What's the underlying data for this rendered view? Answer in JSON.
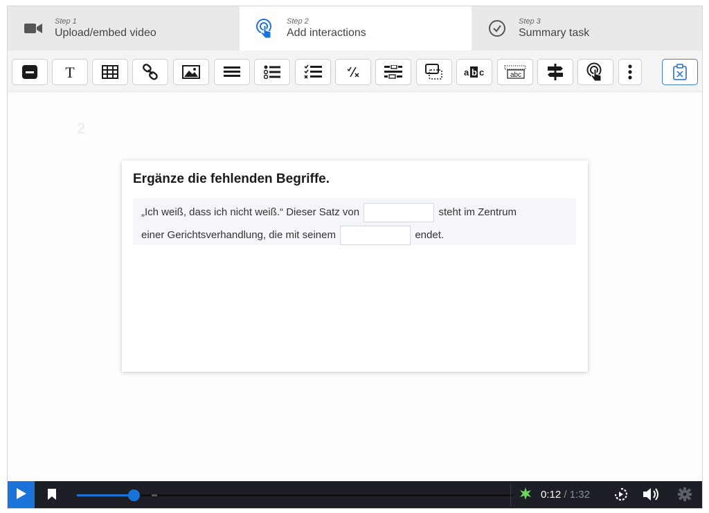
{
  "steps": [
    {
      "num": "Step 1",
      "title": "Upload/embed video",
      "icon": "video-camera-icon",
      "active": false
    },
    {
      "num": "Step 2",
      "title": "Add interactions",
      "icon": "touch-pointer-icon",
      "active": true
    },
    {
      "num": "Step 3",
      "title": "Summary task",
      "icon": "check-circle-icon",
      "active": false
    }
  ],
  "toolbar": {
    "buttons": [
      "label-icon",
      "text-icon",
      "table-icon",
      "link-icon",
      "image-icon",
      "statements-icon",
      "single-choice-icon",
      "multiple-choice-icon",
      "true-false-icon",
      "fill-blanks-icon",
      "drag-drop-icon",
      "mark-words-icon",
      "drag-text-icon",
      "crossroads-icon",
      "navigation-hotspot-icon",
      "more-icon",
      "paste-icon"
    ]
  },
  "canvas": {
    "ghost_text": "2"
  },
  "card": {
    "title": "Ergänze die fehlenden Begriffe.",
    "line1_before": "„Ich weiß, dass ich nicht weiß.“ Dieser Satz von",
    "line1_after": "steht im Zentrum",
    "line2_before": "einer Gerichtsverhandlung, die mit seinem",
    "line2_after": "endet.",
    "blank1_value": "",
    "blank2_value": ""
  },
  "player": {
    "current_time": "0:12",
    "separator": "/",
    "duration": "1:32",
    "progress_fraction": 0.13,
    "accent": "#1a73d9"
  }
}
